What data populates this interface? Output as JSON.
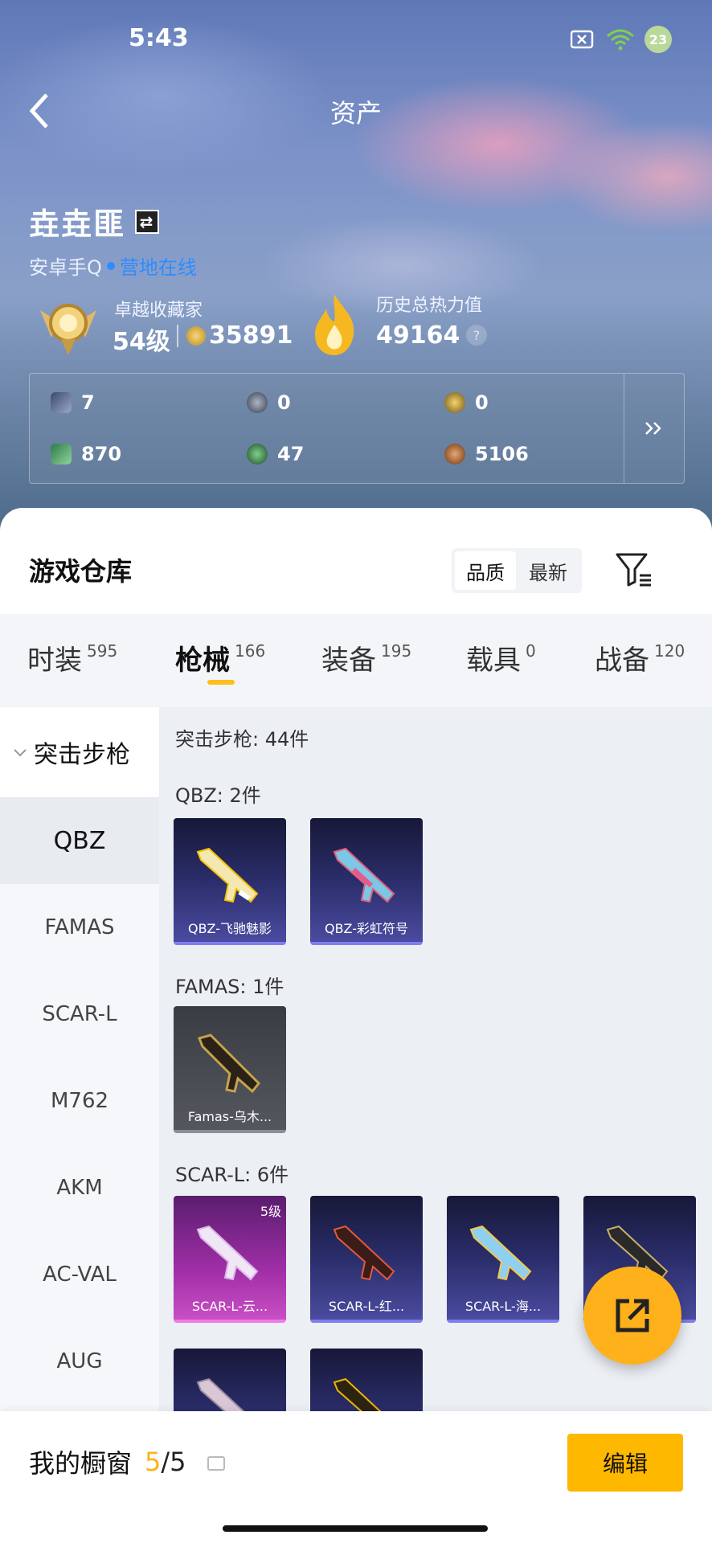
{
  "status": {
    "time": "5:43",
    "battery": "23"
  },
  "nav": {
    "title": "资产"
  },
  "user": {
    "name": "垚垚匪",
    "platform": "安卓手Q",
    "status": "营地在线"
  },
  "stats": {
    "collector_label": "卓越收藏家",
    "level": "54级",
    "coins": "35891",
    "heat_label": "历史总热力值",
    "heat_value": "49164",
    "help": "?"
  },
  "currencies": [
    "7",
    "0",
    "0",
    "870",
    "47",
    "5106"
  ],
  "warehouse": {
    "title": "游戏仓库",
    "sort": [
      "品质",
      "最新"
    ]
  },
  "categories": [
    {
      "name": "时装",
      "count": "595"
    },
    {
      "name": "枪械",
      "count": "166"
    },
    {
      "name": "装备",
      "count": "195"
    },
    {
      "name": "载具",
      "count": "0"
    },
    {
      "name": "战备",
      "count": "120"
    }
  ],
  "sidebar": {
    "group": "突击步枪",
    "items": [
      "QBZ",
      "FAMAS",
      "SCAR-L",
      "M762",
      "AKM",
      "AC-VAL",
      "AUG"
    ]
  },
  "content": {
    "summary": "突击步枪: 44件",
    "sections": [
      {
        "title": "QBZ: 2件",
        "items": [
          {
            "name": "QBZ-飞驰魅影"
          },
          {
            "name": "QBZ-彩虹符号"
          }
        ]
      },
      {
        "title": "FAMAS: 1件",
        "items": [
          {
            "name": "Famas-乌木..."
          }
        ]
      },
      {
        "title": "SCAR-L: 6件",
        "items": [
          {
            "name": "SCAR-L-云...",
            "level": "5级"
          },
          {
            "name": "SCAR-L-红..."
          },
          {
            "name": "SCAR-L-海..."
          },
          {
            "name": ""
          }
        ]
      }
    ]
  },
  "bottom": {
    "label": "我的橱窗",
    "current": "5",
    "total": "/5",
    "edit": "编辑"
  }
}
